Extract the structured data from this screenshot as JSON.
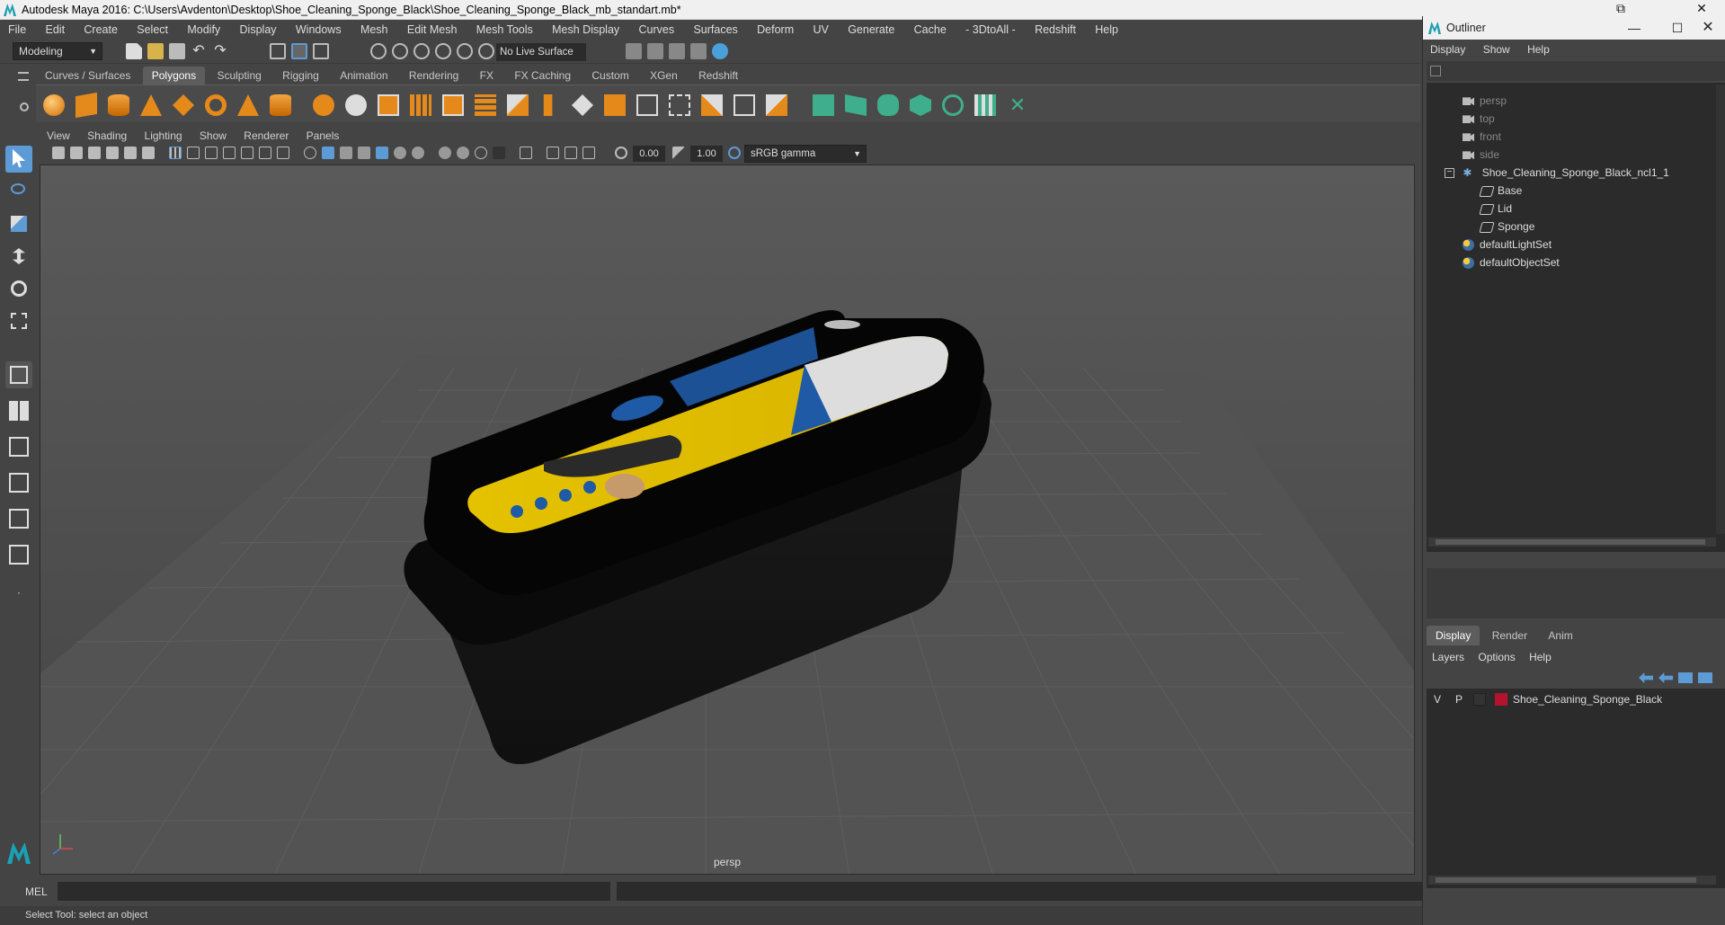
{
  "window": {
    "title": "Autodesk Maya 2016: C:\\Users\\Avdenton\\Desktop\\Shoe_Cleaning_Sponge_Black\\Shoe_Cleaning_Sponge_Black_mb_standart.mb*"
  },
  "menubar": [
    "File",
    "Edit",
    "Create",
    "Select",
    "Modify",
    "Display",
    "Windows",
    "Mesh",
    "Edit Mesh",
    "Mesh Tools",
    "Mesh Display",
    "Curves",
    "Surfaces",
    "Deform",
    "UV",
    "Generate",
    "Cache",
    "- 3DtoAll -",
    "Redshift",
    "Help"
  ],
  "statusline": {
    "mode": "Modeling",
    "live_surface": "No Live Surface"
  },
  "shelf": {
    "tabs": [
      "Curves / Surfaces",
      "Polygons",
      "Sculpting",
      "Rigging",
      "Animation",
      "Rendering",
      "FX",
      "FX Caching",
      "Custom",
      "XGen",
      "Redshift"
    ],
    "active_tab": "Polygons"
  },
  "viewport": {
    "menu": [
      "View",
      "Shading",
      "Lighting",
      "Show",
      "Renderer",
      "Panels"
    ],
    "exposure": "0.00",
    "gamma": "1.00",
    "color_space": "sRGB gamma",
    "camera_label": "persp"
  },
  "cmdline": {
    "label": "MEL"
  },
  "helpline": "Select Tool: select an object",
  "outliner": {
    "title": "Outliner",
    "menu": [
      "Display",
      "Show",
      "Help"
    ],
    "items": [
      {
        "label": "persp",
        "type": "camera"
      },
      {
        "label": "top",
        "type": "camera"
      },
      {
        "label": "front",
        "type": "camera"
      },
      {
        "label": "side",
        "type": "camera"
      },
      {
        "label": "Shoe_Cleaning_Sponge_Black_ncl1_1",
        "type": "group"
      },
      {
        "label": "Base",
        "type": "mesh"
      },
      {
        "label": "Lid",
        "type": "mesh"
      },
      {
        "label": "Sponge",
        "type": "mesh"
      },
      {
        "label": "defaultLightSet",
        "type": "set"
      },
      {
        "label": "defaultObjectSet",
        "type": "set"
      }
    ]
  },
  "layers": {
    "tabs": [
      "Display",
      "Render",
      "Anim"
    ],
    "active_tab": "Display",
    "menu": [
      "Layers",
      "Options",
      "Help"
    ],
    "rows": [
      {
        "v": "V",
        "p": "P",
        "name": "Shoe_Cleaning_Sponge_Black",
        "color": "#b5122e"
      }
    ]
  },
  "colors": {
    "accent": "#5d9bd6",
    "layer_color": "#b5122e",
    "label_yellow": "#e0c100",
    "label_blue": "#1f5aa6"
  }
}
